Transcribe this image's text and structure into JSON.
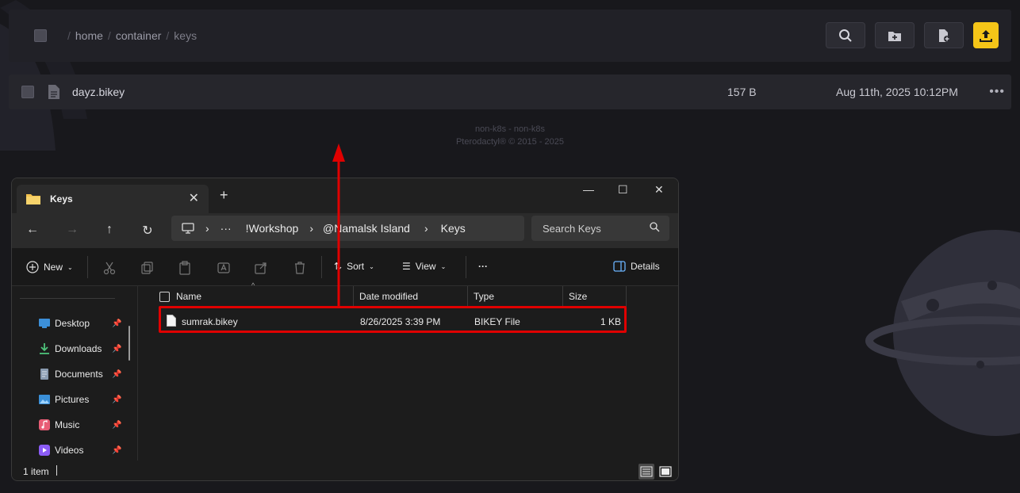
{
  "panel": {
    "breadcrumb": {
      "sep": "/",
      "parts": [
        "home",
        "container",
        "keys"
      ]
    },
    "file": {
      "name": "dayz.bikey",
      "size": "157 B",
      "modified": "Aug 11th, 2025 10:12PM",
      "menu": "•••"
    },
    "footer": {
      "line1": "non-k8s - non-k8s",
      "line2": "Pterodactyl® © 2015 - 2025"
    }
  },
  "explorer": {
    "tab_title": "Keys",
    "new_tab": "+",
    "address": {
      "more": "···",
      "parts": [
        "!Workshop",
        "@Namalsk Island",
        "Keys"
      ]
    },
    "search_placeholder": "Search Keys",
    "commands": {
      "new": "New",
      "sort": "Sort",
      "view": "View",
      "more": "···",
      "details": "Details"
    },
    "sidebar": [
      "Desktop",
      "Downloads",
      "Documents",
      "Pictures",
      "Music",
      "Videos"
    ],
    "columns": {
      "name": "Name",
      "date": "Date modified",
      "type": "Type",
      "size": "Size"
    },
    "file": {
      "name": "sumrak.bikey",
      "date": "8/26/2025 3:39 PM",
      "type": "BIKEY File",
      "size": "1 KB"
    },
    "status": "1 item"
  },
  "colors": {
    "accent_upload": "#f5c518",
    "highlight": "#e00000"
  }
}
